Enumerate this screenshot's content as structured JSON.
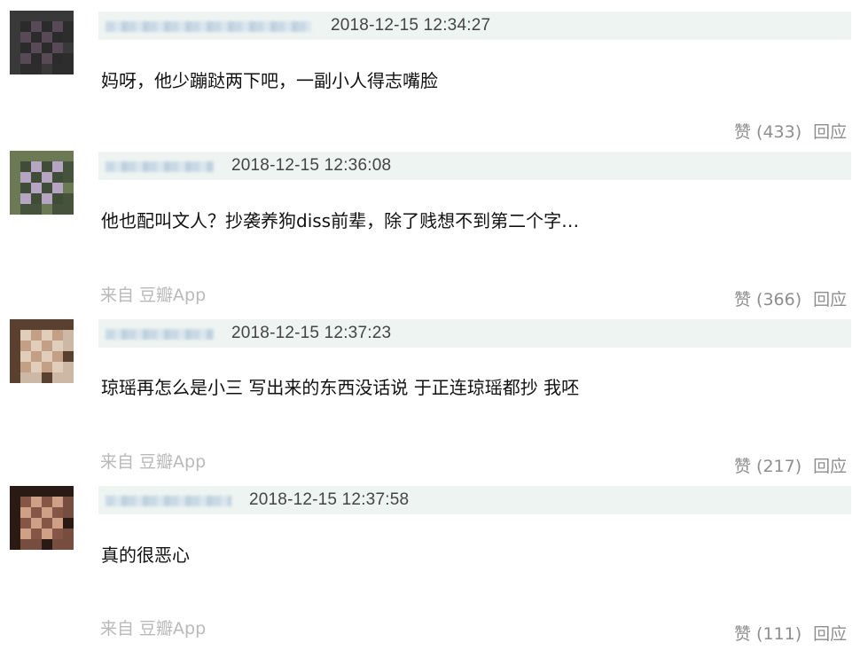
{
  "comments": [
    {
      "username": "",
      "timestamp": "2018-12-15 12:34:27",
      "text": "妈呀，他少蹦跶两下吧，一副小人得志嘴脸",
      "source": "",
      "like_label": "赞 (433)",
      "reply_label": "回应",
      "avatar_colors": [
        "#3a3a3a",
        "#5a4a58",
        "#2a2a2a"
      ]
    },
    {
      "username": "",
      "timestamp": "2018-12-15 12:36:08",
      "text": "他也配叫文人？抄袭养狗diss前辈，除了贱想不到第二个字…",
      "source": "来自 豆瓣App",
      "like_label": "赞 (366)",
      "reply_label": "回应",
      "avatar_colors": [
        "#6b7a55",
        "#b9a8c8",
        "#3d4a36"
      ]
    },
    {
      "username": "",
      "timestamp": "2018-12-15 12:37:23",
      "text": "琼瑶再怎么是小三 写出来的东西没话说 于正连琼瑶都抄 我呸",
      "source": "来自 豆瓣App",
      "like_label": "赞 (217)",
      "reply_label": "回应",
      "avatar_colors": [
        "#5a4030",
        "#c9a58a",
        "#e8d6c2"
      ]
    },
    {
      "username": "",
      "timestamp": "2018-12-15 12:37:58",
      "text": "真的很恶心",
      "source": "来自 豆瓣App",
      "like_label": "赞 (111)",
      "reply_label": "回应",
      "avatar_colors": [
        "#2a1a14",
        "#d9a88c",
        "#8a5a48"
      ]
    }
  ]
}
